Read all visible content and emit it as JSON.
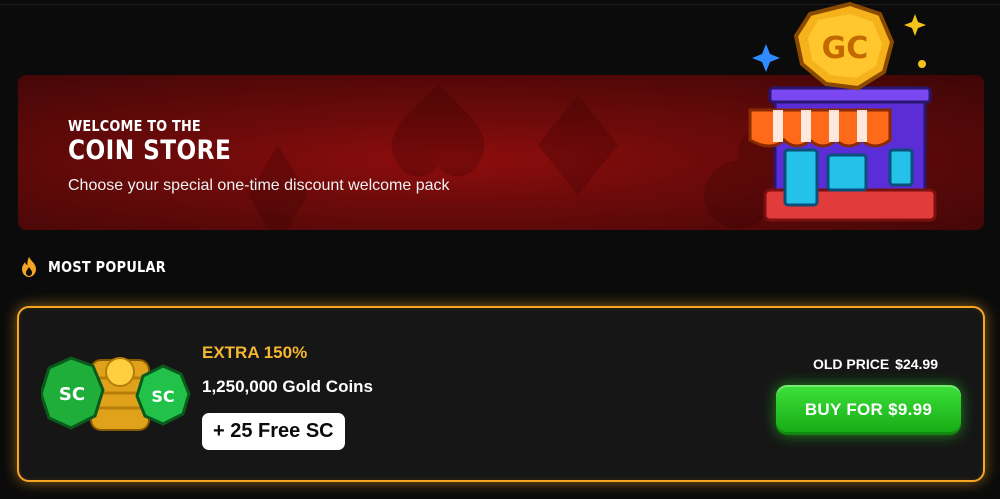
{
  "banner": {
    "welcome": "WELCOME TO THE",
    "store_title": "COIN STORE",
    "subtitle": "Choose your special one-time discount welcome pack",
    "store_badge": "GC"
  },
  "section": {
    "label": "MOST POPULAR",
    "icon": "fire-icon"
  },
  "offer": {
    "extra": "EXTRA 150%",
    "coins": "1,250,000 Gold Coins",
    "bonus": "+ 25 Free SC",
    "coin_badge": "SC",
    "old_price_label": "OLD PRICE",
    "old_price": "$24.99",
    "buy_label": "BUY FOR $9.99"
  },
  "colors": {
    "accent_gold": "#f4a623",
    "buy_green": "#22c21f",
    "banner_red": "#7a0b0b"
  }
}
